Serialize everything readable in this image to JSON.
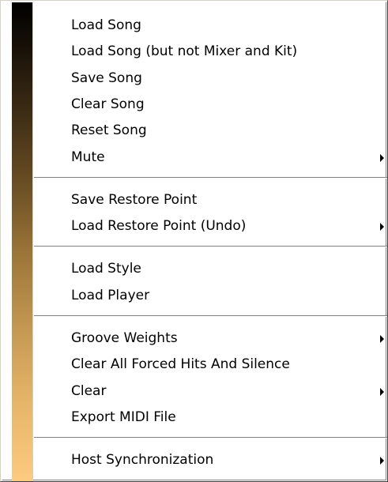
{
  "menu": {
    "items": [
      {
        "label": "Load Song",
        "submenu": false
      },
      {
        "label": "Load Song (but not Mixer and Kit)",
        "submenu": false
      },
      {
        "label": "Save Song",
        "submenu": false
      },
      {
        "label": "Clear Song",
        "submenu": false
      },
      {
        "label": "Reset Song",
        "submenu": false
      },
      {
        "label": "Mute",
        "submenu": true
      },
      {
        "label": "Save Restore Point",
        "submenu": false
      },
      {
        "label": "Load Restore Point (Undo)",
        "submenu": true
      },
      {
        "label": "Load Style",
        "submenu": false
      },
      {
        "label": "Load Player",
        "submenu": false
      },
      {
        "label": "Groove Weights",
        "submenu": true
      },
      {
        "label": "Clear All Forced Hits And Silence",
        "submenu": false
      },
      {
        "label": "Clear",
        "submenu": true
      },
      {
        "label": "Export MIDI File",
        "submenu": false
      },
      {
        "label": "Host Synchronization",
        "submenu": true
      }
    ],
    "submenu_arrow_icon": "triangle-right-icon",
    "colors": {
      "sidebar_top": "#000000",
      "sidebar_bottom": "#fcca80",
      "text": "#000000",
      "background": "#ffffff"
    }
  }
}
